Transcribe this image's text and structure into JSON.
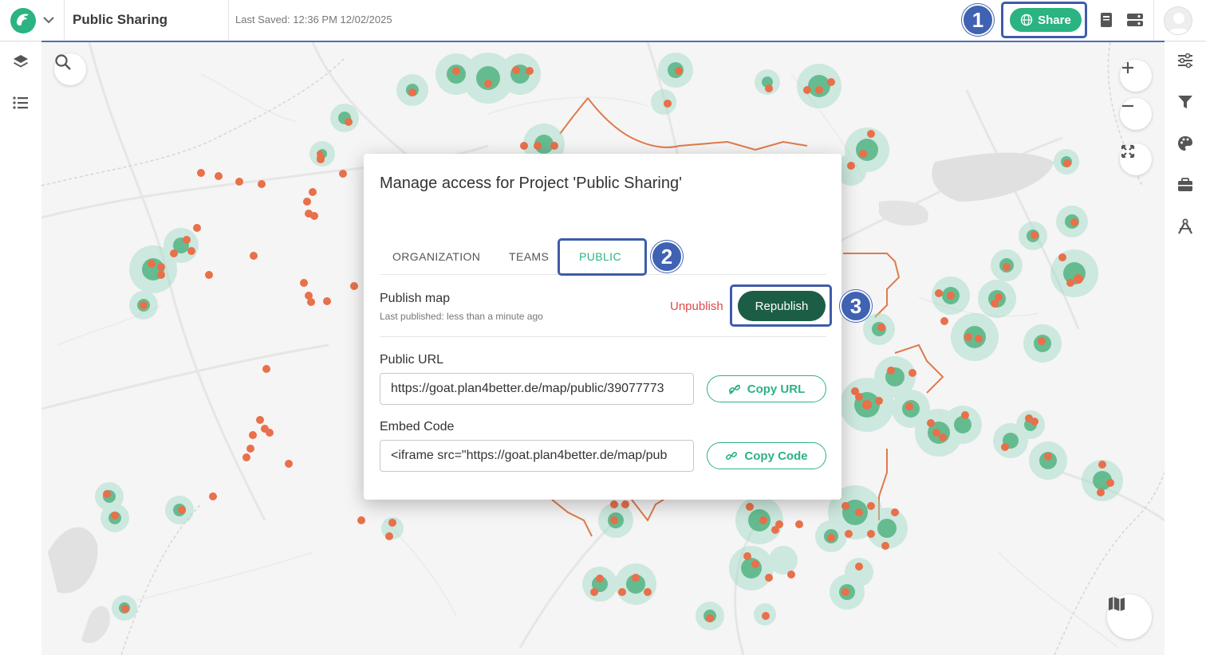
{
  "header": {
    "project_title": "Public Sharing",
    "last_saved": "Last Saved: 12:36 PM 12/02/2025",
    "share_label": "Share"
  },
  "steps": [
    "1",
    "2",
    "3"
  ],
  "dialog": {
    "title": "Manage access for Project 'Public Sharing'",
    "tabs": [
      {
        "label": "ORGANIZATION",
        "active": false
      },
      {
        "label": "TEAMS",
        "active": false
      },
      {
        "label": "PUBLIC",
        "active": true
      }
    ],
    "publish": {
      "label": "Publish map",
      "last_published": "Last published: less than a minute ago",
      "unpublish_label": "Unpublish",
      "republish_label": "Republish"
    },
    "public_url": {
      "label": "Public URL",
      "value": "https://goat.plan4better.de/map/public/39077773",
      "copy_label": "Copy URL"
    },
    "embed": {
      "label": "Embed Code",
      "value": "<iframe src=\"https://goat.plan4better.de/map/pub",
      "copy_label": "Copy Code"
    }
  },
  "colors": {
    "accent": "#2bb381",
    "republish": "#1b5e45",
    "highlight": "#3f62b2",
    "unpublish": "#e04848",
    "boundary": "#e07a4a",
    "points": "#e8704a",
    "heat": "#3aa870"
  },
  "icons": {
    "left_sidebar": [
      "layers-icon",
      "list-icon"
    ],
    "right_sidebar": [
      "sliders-icon",
      "filter-icon",
      "palette-icon",
      "toolbox-icon",
      "tools-icon"
    ],
    "map_controls": [
      "search-icon",
      "zoom-in-icon",
      "zoom-out-icon",
      "fullscreen-icon",
      "basemap-icon"
    ]
  }
}
